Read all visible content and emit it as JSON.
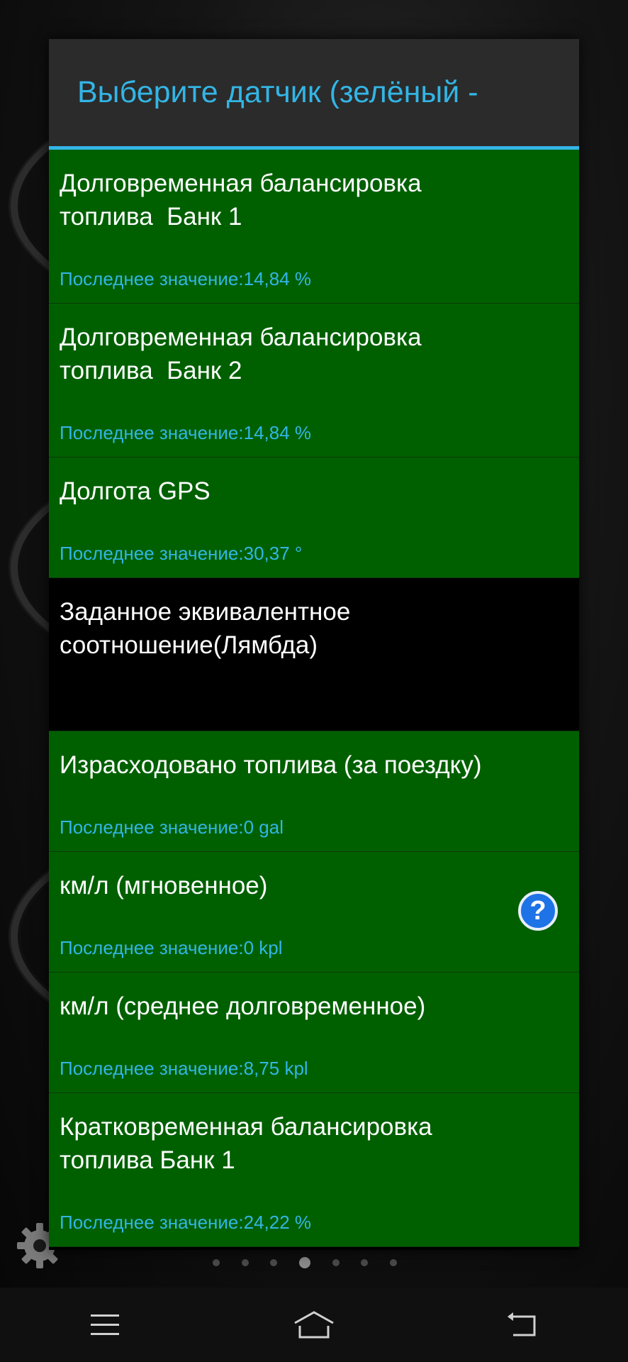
{
  "dialog": {
    "title": "Выберите датчик (зелёный -"
  },
  "sensors": [
    {
      "name": "Долговременная балансировка\nтоплива  Банк 1",
      "value": "Последнее значение:14,84 %",
      "selected": true
    },
    {
      "name": "Долговременная балансировка\nтоплива  Банк 2",
      "value": "Последнее значение:14,84 %",
      "selected": true
    },
    {
      "name": "Долгота GPS",
      "value": "Последнее значение:30,37 °",
      "selected": true
    },
    {
      "name": "Заданное эквивалентное\nсоотношение(Лямбда)",
      "value": "",
      "selected": false
    },
    {
      "name": "Израсходовано топлива (за поездку)",
      "value": "Последнее значение:0 gal",
      "selected": true
    },
    {
      "name": "км/л (мгновенное)",
      "value": "Последнее значение:0 kpl",
      "selected": true,
      "help_icon": "question-icon"
    },
    {
      "name": "км/л (среднее долговременное)",
      "value": "Последнее значение:8,75 kpl",
      "selected": true
    },
    {
      "name": "Кратковременная балансировка\nтоплива Банк 1",
      "value": "Последнее значение:24,22 %",
      "selected": true
    }
  ],
  "page_indicator": {
    "count": 7,
    "active_index": 3
  },
  "colors": {
    "selected_bg": "#006000",
    "accent": "#33b5e5",
    "header_bg": "#2b2b2b"
  },
  "icons": {
    "settings": "gear-icon",
    "nav_menu": "menu-icon",
    "nav_home": "home-icon",
    "nav_back": "back-icon"
  }
}
